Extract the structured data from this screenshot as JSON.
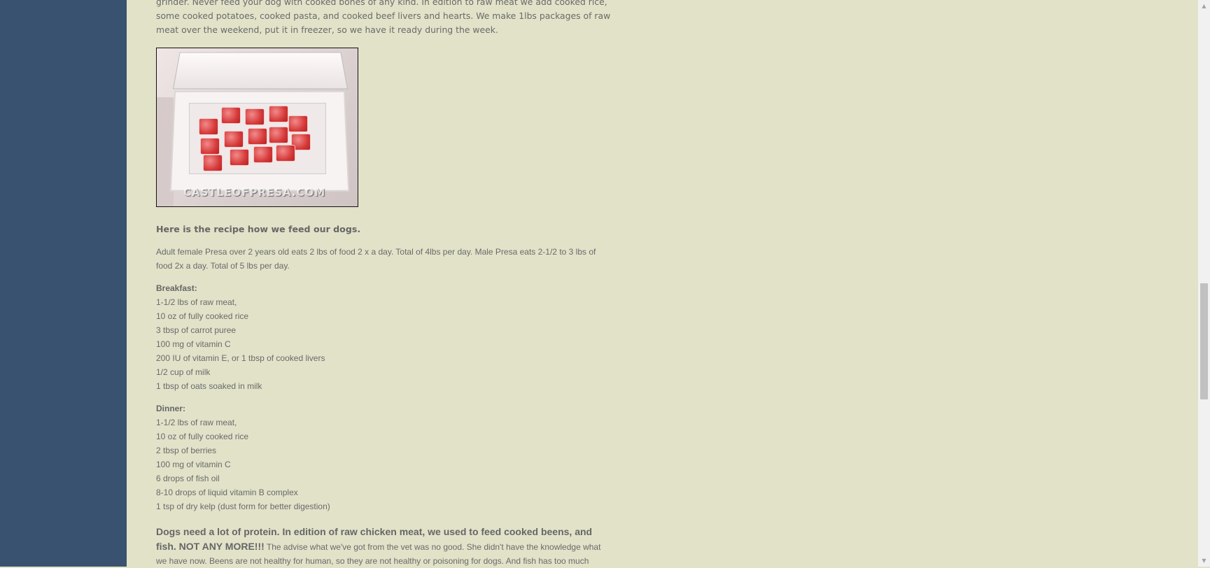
{
  "intro_text": "grinder. Never feed your dog with cooked bones of any kind. In edition to raw meat we add cooked rice, some cooked potatoes, cooked pasta, and cooked beef livers and hearts. We make 1lbs packages of raw meat over the weekend, put it in freezer, so we have it ready during the week.",
  "photo": {
    "watermark": "CASTLEOFPRESA.COM"
  },
  "recipe_heading": "Here is the recipe how we feed our dogs.",
  "feeding_note": "Adult female Presa over 2 years old eats 2 lbs of food 2 x a day. Total of 4lbs per day. Male Presa eats 2-1/2 to 3 lbs of food 2x a day. Total of 5 lbs per day.",
  "breakfast": {
    "label": "Breakfast:",
    "items": [
      "1-1/2 lbs of raw meat,",
      "10 oz of fully cooked rice",
      "3 tbsp of carrot puree",
      "100 mg of vitamin C",
      "200 IU of vitamin E, or 1 tbsp of cooked livers",
      "1/2 cup of milk",
      "1 tbsp of oats soaked in milk"
    ]
  },
  "dinner": {
    "label": "Dinner:",
    "items": [
      "1-1/2 lbs of raw meat,",
      "10 oz of fully cooked rice",
      "2 tbsp of berries",
      "100 mg of vitamin C",
      "6 drops of fish oil",
      "8-10 drops of liquid vitamin B complex",
      "1 tsp of dry kelp (dust form for better digestion)"
    ]
  },
  "closing": {
    "bold": "Dogs need a lot of protein. In edition of raw chicken meat, we used to feed cooked beens, and fish. NOT ANY MORE!!!",
    "text": " The advise what we've got from the vet was no good. She didn't have the knowledge what we have now. Beens are not healthy for human, so they are not healthy or poisoning for dogs. And fish has too much"
  },
  "scrollbar": {
    "up_arrow": "▲",
    "down_arrow": "▼",
    "position_fraction": 0.55
  }
}
